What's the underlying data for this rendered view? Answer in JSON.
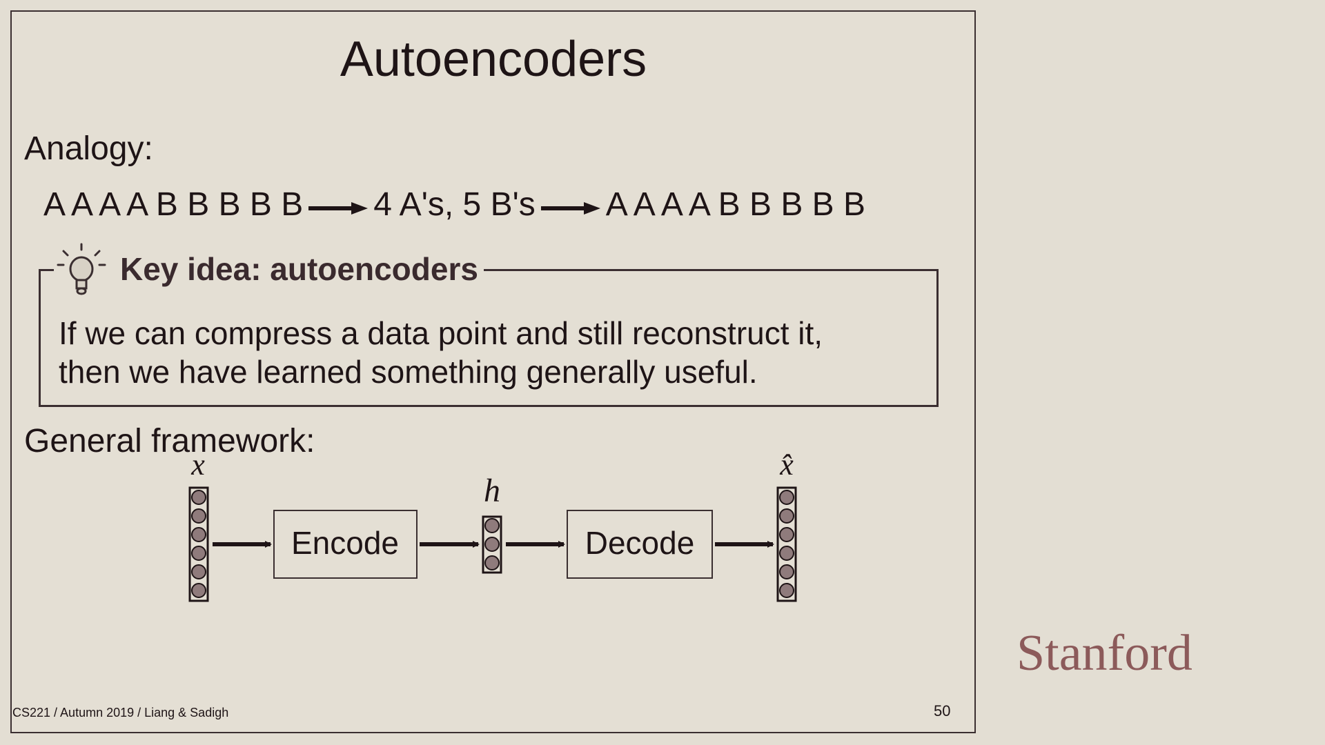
{
  "slide": {
    "title": "Autoencoders",
    "analogy": {
      "label": "Analogy:",
      "input": "A A A A B B B B B",
      "compressed": "4 A's, 5 B's",
      "output": "A A A A B B B B B"
    },
    "key_idea": {
      "title": "Key idea: autoencoders",
      "line1": "If we can compress a data point and still reconstruct it,",
      "line2": "then we have learned something generally useful."
    },
    "framework": {
      "label": "General framework:",
      "input_symbol": "x",
      "hidden_symbol": "h",
      "output_symbol": "x̂",
      "encode_label": "Encode",
      "decode_label": "Decode",
      "input_units": 6,
      "hidden_units": 3,
      "output_units": 6
    },
    "footer": "CS221 / Autumn 2019 / Liang & Sadigh",
    "page_number": "50"
  },
  "brand": {
    "logo_text": "Stanford",
    "logo_color": "#8c5a5a"
  },
  "colors": {
    "background": "#e3ded3",
    "text": "#1e1416",
    "unit_fill": "#8f7b7c"
  }
}
